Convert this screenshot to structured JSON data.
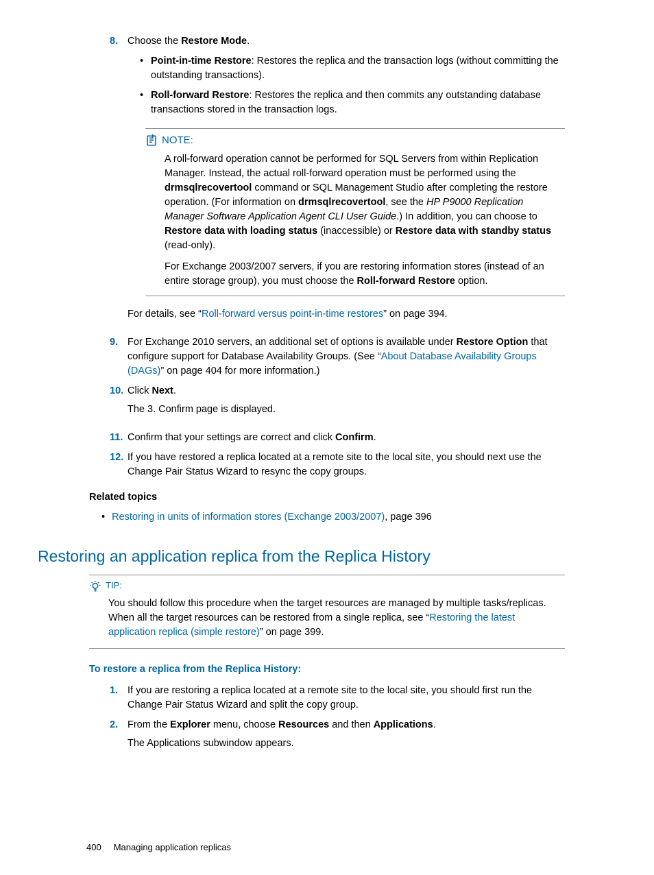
{
  "step8": {
    "num": "8.",
    "text_a": "Choose the ",
    "bold_a": "Restore Mode",
    "text_b": ".",
    "bullet1_bold": "Point-in-time Restore",
    "bullet1_text": ": Restores the replica and the transaction logs (without committing the outstanding transactions).",
    "bullet2_bold": "Roll-forward Restore",
    "bullet2_text": ": Restores the replica and then commits any outstanding database transactions stored in the transaction logs."
  },
  "note": {
    "label": "NOTE:",
    "p1_a": "A roll-forward operation cannot be performed for SQL Servers from within Replication Manager. Instead, the actual roll-forward operation must be performed using the ",
    "p1_b1": "drmsqlrecovertool",
    "p1_c": " command or SQL Management Studio after completing the restore operation. (For information on ",
    "p1_b2": "drmsqlrecovertool",
    "p1_d": ", see the ",
    "p1_i": "HP P9000 Replication Manager Software Application Agent CLI User Guide",
    "p1_e": ".) In addition, you can choose to ",
    "p1_b3": "Restore data with loading status",
    "p1_f": " (inaccessible) or ",
    "p1_b4": "Restore data with standby status",
    "p1_g": " (read-only).",
    "p2_a": "For Exchange 2003/2007 servers, if you are restoring information stores (instead of an entire storage group), you must choose the ",
    "p2_b": "Roll-forward Restore",
    "p2_c": " option."
  },
  "step8_after": {
    "a": "For details, see “",
    "link": "Roll-forward versus point-in-time restores",
    "b": "” on page 394."
  },
  "step9": {
    "num": "9.",
    "a": "For Exchange 2010 servers, an additional set of options is available under ",
    "b1": "Restore Option",
    "b": " that configure support for Database Availability Groups. (See “",
    "link": "About Database Availability Groups (DAGs)",
    "c": "” on page 404 for more information.)"
  },
  "step10": {
    "num": "10.",
    "a": "Click ",
    "b1": "Next",
    "b": ".",
    "after": "The 3. Confirm page is displayed."
  },
  "step11": {
    "num": "11.",
    "a": "Confirm that your settings are correct and click ",
    "b1": "Confirm",
    "b": "."
  },
  "step12": {
    "num": "12.",
    "text": "If you have restored a replica located at a remote site to the local site, you should next use the Change Pair Status Wizard to resync the copy groups."
  },
  "related": {
    "head": "Related topics",
    "link": "Restoring in units of information stores (Exchange 2003/2007)",
    "tail": ", page 396"
  },
  "section_title": "Restoring an application replica from the Replica History",
  "tip": {
    "label": "TIP:",
    "a": "You should follow this procedure when the target resources are managed by multiple tasks/replicas. When all the target resources can be restored from a single replica, see “",
    "link": "Restoring the latest application replica (simple restore)",
    "b": "” on page 399."
  },
  "proc_head": "To restore a replica from the Replica History:",
  "proc1": {
    "num": "1.",
    "text": "If you are restoring a replica located at a remote site to the local site, you should first run the Change Pair Status Wizard and split the copy group."
  },
  "proc2": {
    "num": "2.",
    "a": "From the ",
    "b1": "Explorer",
    "b": " menu, choose ",
    "b2": "Resources",
    "c": " and then ",
    "b3": "Applications",
    "d": ".",
    "after": "The Applications subwindow appears."
  },
  "footer": {
    "page": "400",
    "chapter": "Managing application replicas"
  }
}
